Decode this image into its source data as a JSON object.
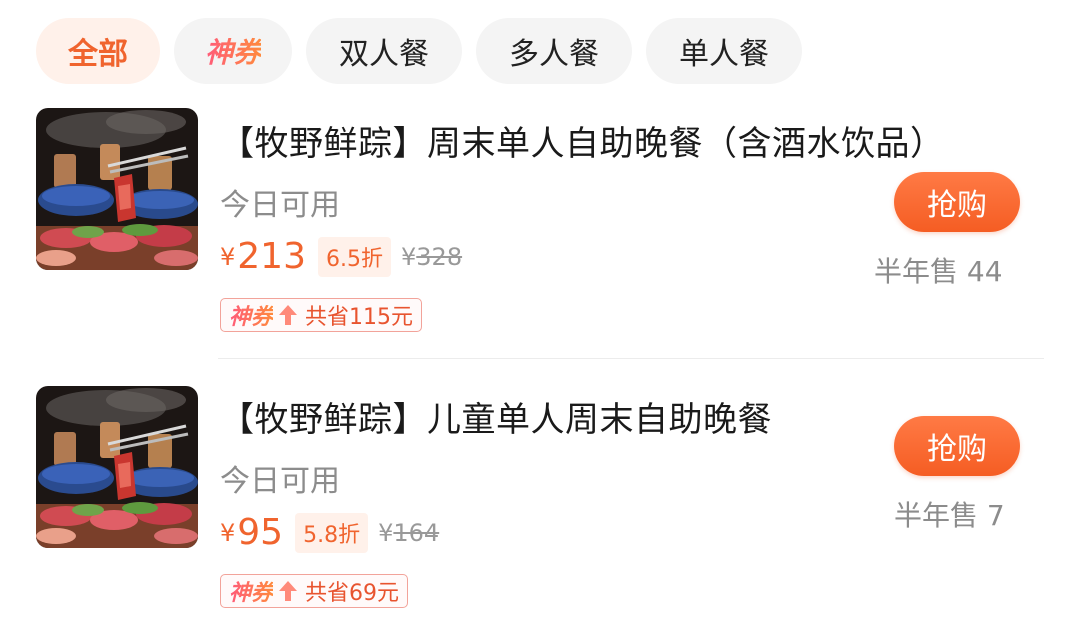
{
  "tabs": {
    "all": "全部",
    "coupon": "神券",
    "double": "双人餐",
    "multi": "多人餐",
    "single": "单人餐"
  },
  "items": [
    {
      "title": "【牧野鲜踪】周末单人自助晚餐（含酒水饮品）",
      "availability": "今日可用",
      "currency": "¥",
      "price": "213",
      "discount": "6.5折",
      "original_currency": "¥",
      "original_price": "328",
      "coupon_label": "神券",
      "savings": "共省115元",
      "buy_label": "抢购",
      "sold": "半年售 44",
      "image": "hotpot-photo"
    },
    {
      "title": "【牧野鲜踪】儿童单人周末自助晚餐",
      "availability": "今日可用",
      "currency": "¥",
      "price": "95",
      "discount": "5.8折",
      "original_currency": "¥",
      "original_price": "164",
      "coupon_label": "神券",
      "savings": "共省69元",
      "buy_label": "抢购",
      "sold": "半年售 7",
      "image": "hotpot-photo"
    }
  ],
  "colors": {
    "accent": "#f0642e",
    "button": "#f55d23",
    "muted": "#8c8c8c"
  }
}
